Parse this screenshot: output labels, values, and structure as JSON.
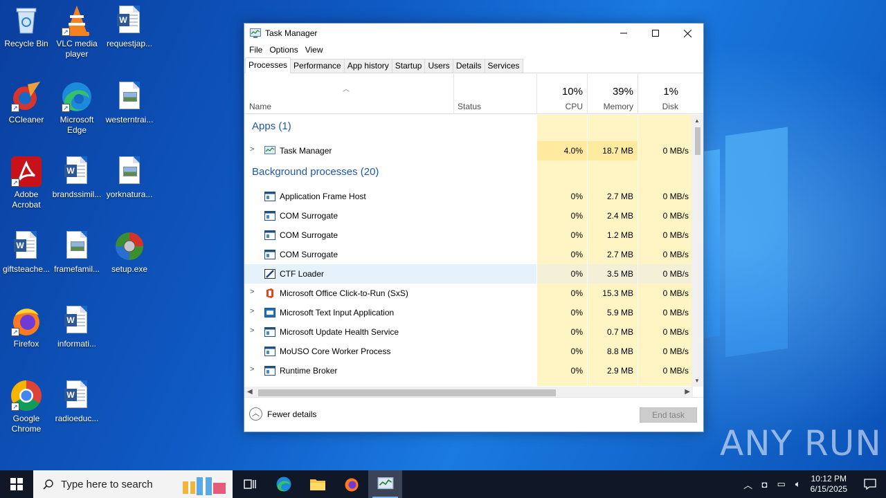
{
  "desktop": {
    "icons": [
      {
        "label": "Recycle Bin"
      },
      {
        "label": "VLC media player"
      },
      {
        "label": "requestjap..."
      },
      {
        "label": "CCleaner"
      },
      {
        "label": "Microsoft Edge"
      },
      {
        "label": "westerntrai..."
      },
      {
        "label": "Adobe Acrobat"
      },
      {
        "label": "brandssimil..."
      },
      {
        "label": "yorknatura..."
      },
      {
        "label": "giftsteache..."
      },
      {
        "label": "framefamil..."
      },
      {
        "label": "setup.exe"
      },
      {
        "label": "Firefox"
      },
      {
        "label": "informati..."
      },
      {
        "label": "Google Chrome"
      },
      {
        "label": "radioeduc..."
      }
    ]
  },
  "window": {
    "title": "Task Manager",
    "menu": [
      "File",
      "Options",
      "View"
    ],
    "tabs": [
      "Processes",
      "Performance",
      "App history",
      "Startup",
      "Users",
      "Details",
      "Services"
    ],
    "active_tab": "Processes"
  },
  "columns": {
    "name": "Name",
    "status": "Status",
    "cpu": {
      "pct": "10%",
      "label": "CPU"
    },
    "memory": {
      "pct": "39%",
      "label": "Memory"
    },
    "disk": {
      "pct": "1%",
      "label": "Disk"
    }
  },
  "groups": {
    "apps": "Apps (1)",
    "background": "Background processes (20)"
  },
  "apps": [
    {
      "name": "Task Manager",
      "cpu": "4.0%",
      "memory": "18.7 MB",
      "disk": "0 MB/s"
    }
  ],
  "background": [
    {
      "name": "Application Frame Host",
      "cpu": "0%",
      "memory": "2.7 MB",
      "disk": "0 MB/s"
    },
    {
      "name": "COM Surrogate",
      "cpu": "0%",
      "memory": "2.4 MB",
      "disk": "0 MB/s"
    },
    {
      "name": "COM Surrogate",
      "cpu": "0%",
      "memory": "1.2 MB",
      "disk": "0 MB/s"
    },
    {
      "name": "COM Surrogate",
      "cpu": "0%",
      "memory": "2.7 MB",
      "disk": "0 MB/s"
    },
    {
      "name": "CTF Loader",
      "cpu": "0%",
      "memory": "3.5 MB",
      "disk": "0 MB/s"
    },
    {
      "name": "Microsoft Office Click-to-Run (SxS)",
      "cpu": "0%",
      "memory": "15.3 MB",
      "disk": "0 MB/s"
    },
    {
      "name": "Microsoft Text Input Application",
      "cpu": "0%",
      "memory": "5.9 MB",
      "disk": "0 MB/s"
    },
    {
      "name": "Microsoft Update Health Service",
      "cpu": "0%",
      "memory": "0.7 MB",
      "disk": "0 MB/s"
    },
    {
      "name": "MoUSO Core Worker Process",
      "cpu": "0%",
      "memory": "8.8 MB",
      "disk": "0 MB/s"
    },
    {
      "name": "Runtime Broker",
      "cpu": "0%",
      "memory": "2.9 MB",
      "disk": "0 MB/s"
    }
  ],
  "footer": {
    "fewer_details": "Fewer details",
    "end_task": "End task"
  },
  "watermark": "ANY RUN",
  "taskbar": {
    "search_placeholder": "Type here to search",
    "time": "10:12 PM",
    "date": "6/15/2025"
  }
}
